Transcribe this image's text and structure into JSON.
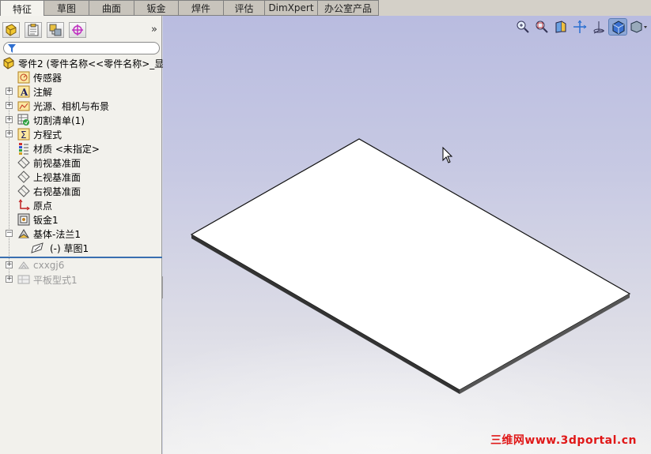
{
  "tabs": [
    "特征",
    "草图",
    "曲面",
    "钣金",
    "焊件",
    "评估",
    "DimXpert",
    "办公室产品"
  ],
  "panel": {
    "expand_glyph": "»",
    "root": "零件2  (零件名称<<零件名称>_显",
    "items": [
      {
        "label": "传感器",
        "icon": "sensor-icon"
      },
      {
        "label": "注解",
        "icon": "annotation-icon"
      },
      {
        "label": "光源、相机与布景",
        "icon": "lights-icon"
      },
      {
        "label": "切割清单(1)",
        "icon": "cutlist-icon"
      },
      {
        "label": "方程式",
        "icon": "equation-icon"
      },
      {
        "label": "材质 <未指定>",
        "icon": "material-icon"
      },
      {
        "label": "前视基准面",
        "icon": "plane-icon"
      },
      {
        "label": "上视基准面",
        "icon": "plane-icon"
      },
      {
        "label": "右视基准面",
        "icon": "plane-icon"
      },
      {
        "label": "原点",
        "icon": "origin-icon"
      },
      {
        "label": "钣金1",
        "icon": "sheetmetal-icon"
      },
      {
        "label": "基体-法兰1",
        "icon": "baseflange-icon"
      },
      {
        "label": "(-) 草图1",
        "icon": "sketch-icon"
      },
      {
        "label": "cxxgj6",
        "icon": "feature-icon"
      },
      {
        "label": "平板型式1",
        "icon": "flatpattern-icon"
      }
    ]
  },
  "viewport": {
    "watermark": "三维网www.3dportal.cn",
    "toolbar": [
      "zoom-to-fit-icon",
      "zoom-area-icon",
      "section-view-icon",
      "view-orientation-icon",
      "display-style-icon",
      "hide-show-icon"
    ]
  }
}
